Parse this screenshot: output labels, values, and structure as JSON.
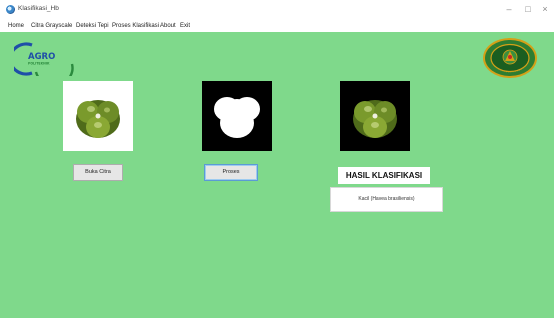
{
  "window": {
    "title": "Klasifikasi_Hb",
    "controls": {
      "minimize": "–",
      "maximize": "□",
      "close": "×"
    }
  },
  "menu": {
    "items": [
      {
        "label": "Home"
      },
      {
        "label": "Citra Grayscale"
      },
      {
        "label": "Deteksi Tepi"
      },
      {
        "label": "Proses Klasifikasi"
      },
      {
        "label": "About"
      },
      {
        "label": "Exit"
      }
    ]
  },
  "logos": {
    "left_text_top": "AGRO",
    "left_text_bottom": "POLITEKNIK"
  },
  "panels": {
    "original": {
      "icon": "cabbage-image"
    },
    "segmented": {
      "icon": "binary-mask-image"
    },
    "masked": {
      "icon": "masked-cabbage-image"
    }
  },
  "buttons": {
    "load": "Buka Citra",
    "process": "Proses"
  },
  "result": {
    "title": "HASIL KLASIFIKASI",
    "value": "Kacil (Havea brasiliensis)"
  },
  "colors": {
    "background": "#7fd98b",
    "logo_blue": "#1f4fa8",
    "emblem_green": "#2e7d32",
    "emblem_gold": "#d4a017"
  }
}
